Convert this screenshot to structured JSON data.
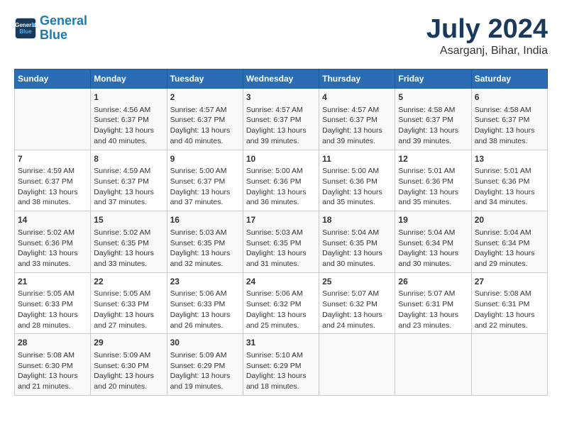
{
  "header": {
    "logo_line1": "General",
    "logo_line2": "Blue",
    "month": "July 2024",
    "location": "Asarganj, Bihar, India"
  },
  "columns": [
    "Sunday",
    "Monday",
    "Tuesday",
    "Wednesday",
    "Thursday",
    "Friday",
    "Saturday"
  ],
  "weeks": [
    [
      {
        "day": "",
        "info": ""
      },
      {
        "day": "1",
        "info": "Sunrise: 4:56 AM\nSunset: 6:37 PM\nDaylight: 13 hours\nand 40 minutes."
      },
      {
        "day": "2",
        "info": "Sunrise: 4:57 AM\nSunset: 6:37 PM\nDaylight: 13 hours\nand 40 minutes."
      },
      {
        "day": "3",
        "info": "Sunrise: 4:57 AM\nSunset: 6:37 PM\nDaylight: 13 hours\nand 39 minutes."
      },
      {
        "day": "4",
        "info": "Sunrise: 4:57 AM\nSunset: 6:37 PM\nDaylight: 13 hours\nand 39 minutes."
      },
      {
        "day": "5",
        "info": "Sunrise: 4:58 AM\nSunset: 6:37 PM\nDaylight: 13 hours\nand 39 minutes."
      },
      {
        "day": "6",
        "info": "Sunrise: 4:58 AM\nSunset: 6:37 PM\nDaylight: 13 hours\nand 38 minutes."
      }
    ],
    [
      {
        "day": "7",
        "info": "Sunrise: 4:59 AM\nSunset: 6:37 PM\nDaylight: 13 hours\nand 38 minutes."
      },
      {
        "day": "8",
        "info": "Sunrise: 4:59 AM\nSunset: 6:37 PM\nDaylight: 13 hours\nand 37 minutes."
      },
      {
        "day": "9",
        "info": "Sunrise: 5:00 AM\nSunset: 6:37 PM\nDaylight: 13 hours\nand 37 minutes."
      },
      {
        "day": "10",
        "info": "Sunrise: 5:00 AM\nSunset: 6:36 PM\nDaylight: 13 hours\nand 36 minutes."
      },
      {
        "day": "11",
        "info": "Sunrise: 5:00 AM\nSunset: 6:36 PM\nDaylight: 13 hours\nand 35 minutes."
      },
      {
        "day": "12",
        "info": "Sunrise: 5:01 AM\nSunset: 6:36 PM\nDaylight: 13 hours\nand 35 minutes."
      },
      {
        "day": "13",
        "info": "Sunrise: 5:01 AM\nSunset: 6:36 PM\nDaylight: 13 hours\nand 34 minutes."
      }
    ],
    [
      {
        "day": "14",
        "info": "Sunrise: 5:02 AM\nSunset: 6:36 PM\nDaylight: 13 hours\nand 33 minutes."
      },
      {
        "day": "15",
        "info": "Sunrise: 5:02 AM\nSunset: 6:35 PM\nDaylight: 13 hours\nand 33 minutes."
      },
      {
        "day": "16",
        "info": "Sunrise: 5:03 AM\nSunset: 6:35 PM\nDaylight: 13 hours\nand 32 minutes."
      },
      {
        "day": "17",
        "info": "Sunrise: 5:03 AM\nSunset: 6:35 PM\nDaylight: 13 hours\nand 31 minutes."
      },
      {
        "day": "18",
        "info": "Sunrise: 5:04 AM\nSunset: 6:35 PM\nDaylight: 13 hours\nand 30 minutes."
      },
      {
        "day": "19",
        "info": "Sunrise: 5:04 AM\nSunset: 6:34 PM\nDaylight: 13 hours\nand 30 minutes."
      },
      {
        "day": "20",
        "info": "Sunrise: 5:04 AM\nSunset: 6:34 PM\nDaylight: 13 hours\nand 29 minutes."
      }
    ],
    [
      {
        "day": "21",
        "info": "Sunrise: 5:05 AM\nSunset: 6:33 PM\nDaylight: 13 hours\nand 28 minutes."
      },
      {
        "day": "22",
        "info": "Sunrise: 5:05 AM\nSunset: 6:33 PM\nDaylight: 13 hours\nand 27 minutes."
      },
      {
        "day": "23",
        "info": "Sunrise: 5:06 AM\nSunset: 6:33 PM\nDaylight: 13 hours\nand 26 minutes."
      },
      {
        "day": "24",
        "info": "Sunrise: 5:06 AM\nSunset: 6:32 PM\nDaylight: 13 hours\nand 25 minutes."
      },
      {
        "day": "25",
        "info": "Sunrise: 5:07 AM\nSunset: 6:32 PM\nDaylight: 13 hours\nand 24 minutes."
      },
      {
        "day": "26",
        "info": "Sunrise: 5:07 AM\nSunset: 6:31 PM\nDaylight: 13 hours\nand 23 minutes."
      },
      {
        "day": "27",
        "info": "Sunrise: 5:08 AM\nSunset: 6:31 PM\nDaylight: 13 hours\nand 22 minutes."
      }
    ],
    [
      {
        "day": "28",
        "info": "Sunrise: 5:08 AM\nSunset: 6:30 PM\nDaylight: 13 hours\nand 21 minutes."
      },
      {
        "day": "29",
        "info": "Sunrise: 5:09 AM\nSunset: 6:30 PM\nDaylight: 13 hours\nand 20 minutes."
      },
      {
        "day": "30",
        "info": "Sunrise: 5:09 AM\nSunset: 6:29 PM\nDaylight: 13 hours\nand 19 minutes."
      },
      {
        "day": "31",
        "info": "Sunrise: 5:10 AM\nSunset: 6:29 PM\nDaylight: 13 hours\nand 18 minutes."
      },
      {
        "day": "",
        "info": ""
      },
      {
        "day": "",
        "info": ""
      },
      {
        "day": "",
        "info": ""
      }
    ]
  ]
}
